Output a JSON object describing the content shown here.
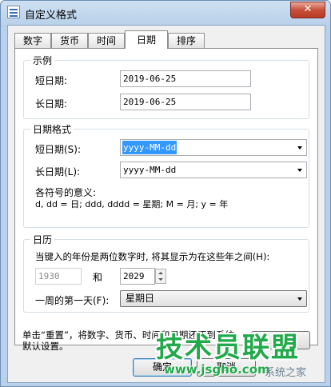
{
  "window": {
    "title": "自定义格式",
    "close_glyph": "✕"
  },
  "tabs": [
    {
      "label": "数字",
      "active": false
    },
    {
      "label": "货币",
      "active": false
    },
    {
      "label": "时间",
      "active": false
    },
    {
      "label": "日期",
      "active": true
    },
    {
      "label": "排序",
      "active": false
    }
  ],
  "example": {
    "group_title": "示例",
    "short_date_label": "短日期:",
    "short_date_value": "2019-06-25",
    "long_date_label": "长日期:",
    "long_date_value": "2019-06-25"
  },
  "date_format": {
    "group_title": "日期格式",
    "short_date_label": "短日期(S):",
    "short_date_value": "yyyy-MM-dd",
    "long_date_label": "长日期(L):",
    "long_date_value": "yyyy-MM-dd",
    "symbols_title": "各符号的意义:",
    "symbols_desc": "d, dd = 日;  ddd, dddd = 星期;  M = 月;  y = 年"
  },
  "calendar": {
    "group_title": "日历",
    "two_digit_label": "当键入的年份是两位数字时, 将其显示为在这些年之间(H):",
    "year_from": "1930",
    "and_label": "和",
    "year_to": "2029",
    "first_day_label": "一周的第一天(F):",
    "first_day_value": "星期日"
  },
  "footer": {
    "reset_text": "单击“重置”，将数字、货币、时间和日期还原到系统默认设置。",
    "reset_button": "重置",
    "ok_button": "确定",
    "cancel_button": "取消"
  },
  "watermark": {
    "main": "技术员联盟",
    "url": "www.jsgho.com",
    "sub": "系统之家"
  },
  "colors": {
    "selection": "#3399ff",
    "watermark_green": "#21a94a"
  }
}
